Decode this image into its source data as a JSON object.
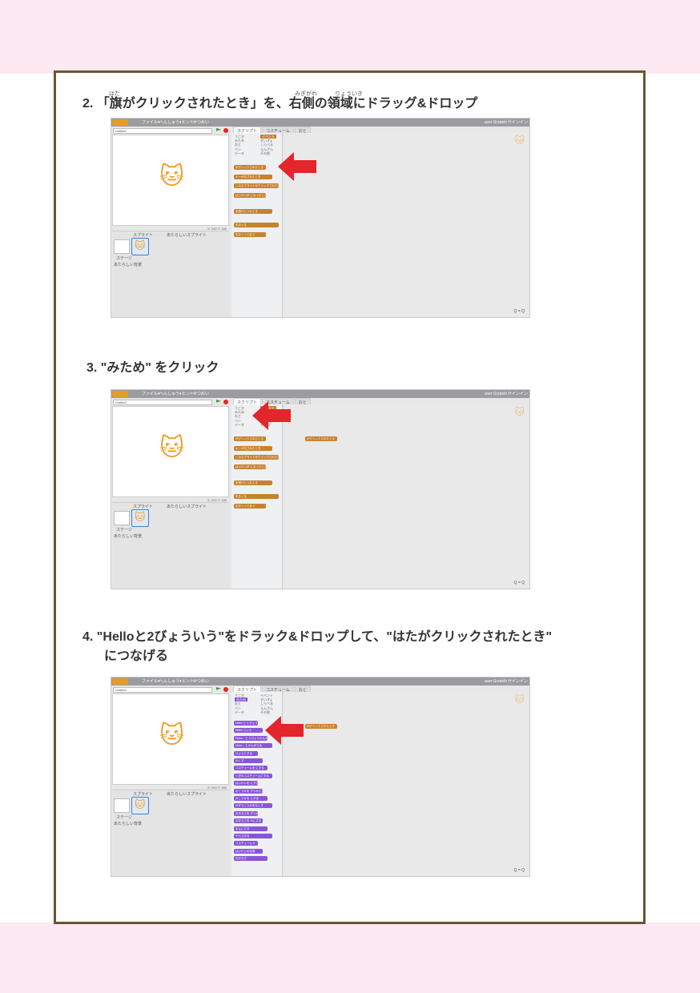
{
  "steps": [
    {
      "number": "2.",
      "text": "「旗がクリックされたとき」を、右側の領域にドラッグ&ドロップ",
      "ruby": [
        {
          "text": "はた"
        },
        {
          "text": "みぎがわ"
        },
        {
          "text": "りょういき"
        }
      ]
    },
    {
      "number": "3.",
      "text": "\"みため\" をクリック"
    },
    {
      "number": "4.",
      "text": "\"Helloと2びょういう\"をドラック&ドロップして、\"はたがクリックされたとき\"",
      "text2": "につなげる"
    }
  ],
  "scratch": {
    "menu": {
      "file": "ファイル▾",
      "edit": "へんしゅう▾",
      "tips": "ヒント",
      "about": "せつめい",
      "user": "user-Scratch",
      "signin": "サインイン"
    },
    "project_title": "Untitled",
    "tabs": {
      "scripts": "スクリプト",
      "costumes": "コスチューム",
      "sounds": "おと"
    },
    "categories_left": [
      "うごき",
      "みため",
      "おと",
      "ペン",
      "データ"
    ],
    "categories_right": [
      "イベント",
      "せいぎょ",
      "しらべる",
      "えんざん",
      "その他"
    ],
    "sprites_label": "スプライト",
    "new_sprite_label": "あたらしいスプライト",
    "stage_label": "ステージ",
    "new_backdrop_label": "あたらしい背景",
    "sprite_name": "Sprite1",
    "coords": "X: 240  Y: 180",
    "zoom": "Q = Q",
    "event_blocks": [
      "がクリックされたとき",
      "キーがおされたとき",
      "このスプライトがクリックされたとき",
      "はいけいが になったとき",
      "を受けとったとき",
      "をおくる",
      "をおくってまつ"
    ],
    "looks_blocks": [
      "Hello! と 2 びょういう",
      "Hello! という",
      "Hmm... と 2 びょうかんがえる",
      "Hmm... とかんがえる",
      "ひょうじする",
      "かくす",
      "コスチュームを にする",
      "つぎのコスチュームにする",
      "はいけいを にする",
      "のこうかを ずつかえる",
      "のこうかを にする",
      "がぞうこうかをなくす",
      "おおきさを ずつかえる",
      "おおきさを %にする",
      "まえにだす",
      "そうさげる",
      "コスチューム #",
      "はいけいの名前",
      "おおきさ"
    ],
    "dropped_block": "がクリックされたとき"
  },
  "colors": {
    "frame": "#6b5433",
    "pink": "#fde9f1",
    "event": "#c8812e",
    "looks": "#8a55d7",
    "arrow": "#e2262b"
  }
}
